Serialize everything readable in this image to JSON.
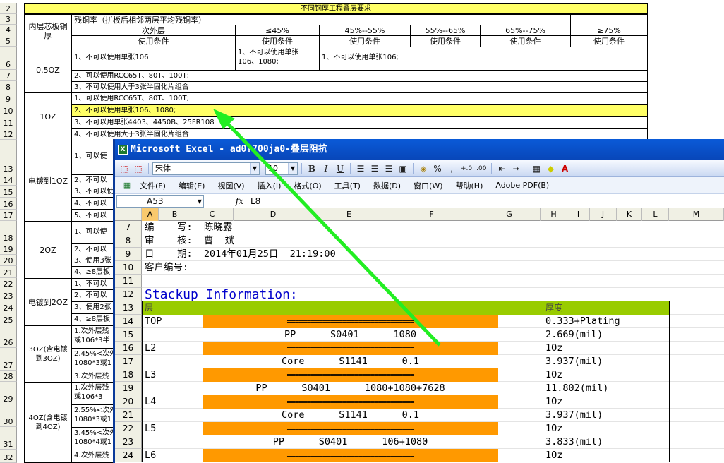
{
  "background_sheet": {
    "row_numbers": [
      "2",
      "3",
      "4",
      "5",
      "6",
      "7",
      "8",
      "9",
      "10",
      "11",
      "12",
      "13",
      "14",
      "15",
      "16",
      "17",
      "18",
      "19",
      "20",
      "21",
      "22",
      "23",
      "24",
      "25",
      "26",
      "27",
      "28",
      "29",
      "30",
      "31",
      "32"
    ],
    "title": "不同铜厚工程叠层要求",
    "header_inner": "内层芯板铜厚",
    "header_residual": "残铜率（拼板后相邻两层平均残铜率）",
    "header_secondary": "次外层",
    "ranges": [
      "≤45%",
      "45%--55%",
      "55%--65%",
      "65%--75%",
      "≥75%"
    ],
    "use_condition": "使用条件",
    "groups": [
      {
        "thickness": "0.5OZ",
        "lines": [
          "1、不可以使用单张106",
          "2、可以使用RCC65T、80T、100T;",
          "3、不可以使用大于3张半固化片组合"
        ],
        "col2": "1、不可以使用单张106、1080;",
        "col3": "1、不可以使用单张106;"
      },
      {
        "thickness": "1OZ",
        "lines": [
          "1、可以使用RCC65T、80T、100T;",
          "2、不可以使用单张106、1080;",
          "3、不可以用单张4403、4450B、25FR108",
          "4、不可以使用大于3张半固化片组合"
        ]
      },
      {
        "thickness": "电镀到1OZ",
        "lines": [
          "1、可以使",
          "2、不可以",
          "3、不可以使",
          "4、不可以",
          "5、不可以"
        ]
      },
      {
        "thickness": "2OZ",
        "lines": [
          "1、可以使",
          "2、不可以",
          "3、使用3张",
          "4、≥8层板"
        ]
      },
      {
        "thickness": "电镀到2OZ",
        "lines": [
          "1、不可以",
          "2、不可以",
          "3、使用2张",
          "4、≥8层板"
        ]
      },
      {
        "thickness": "3OZ(含电镀到3OZ)",
        "lines": [
          "1.次外层残",
          "或106*3半",
          "2.45%<次外",
          "1080*3或1",
          "3.次外层残"
        ]
      },
      {
        "thickness": "4OZ(含电镀到4OZ)",
        "lines": [
          "1.次外层残",
          "或106*3",
          "2.55%<次外",
          "1080*3或1",
          "3.45%<次外",
          "1080*4或1",
          "4.次外层残"
        ]
      }
    ]
  },
  "excel_window": {
    "title": "Microsoft Excel - ad0?700ja0-叠层阻抗",
    "toolbar": {
      "font_name": "宋体",
      "font_size": "10",
      "bold": "B",
      "italic": "I",
      "underline": "U",
      "percent": "%",
      "comma": ","
    },
    "menu": [
      "文件(F)",
      "编辑(E)",
      "视图(V)",
      "插入(I)",
      "格式(O)",
      "工具(T)",
      "数据(D)",
      "窗口(W)",
      "帮助(H)",
      "Adobe PDF(B)"
    ],
    "name_box": "A53",
    "fx_label": "fx",
    "formula_value": "L8",
    "columns": [
      "A",
      "B",
      "C",
      "D",
      "E",
      "F",
      "G",
      "H",
      "I",
      "J",
      "K",
      "L",
      "M"
    ],
    "selected_column": "A",
    "rows": [
      {
        "n": "7",
        "a": "编    写:  陈晓露"
      },
      {
        "n": "8",
        "a": "审    核:  曹  斌"
      },
      {
        "n": "9",
        "a": "日    期:  2014年01月25日  21:19:00"
      },
      {
        "n": "10",
        "a": "客户编号:"
      },
      {
        "n": "11",
        "a": ""
      },
      {
        "n": "12",
        "a": "Stackup Information:"
      },
      {
        "n": "13",
        "a": "层",
        "thick": "厚度"
      },
      {
        "n": "14",
        "a": "TOP",
        "mid": "================================",
        "thick": "0.333+Plating"
      },
      {
        "n": "15",
        "a": "",
        "mid": "PP      S0401      1080",
        "thick": "2.669(mil)"
      },
      {
        "n": "16",
        "a": "L2",
        "mid": "================================",
        "thick": "1Oz"
      },
      {
        "n": "17",
        "a": "",
        "mid": "Core      S1141      0.1",
        "thick": "3.937(mil)"
      },
      {
        "n": "18",
        "a": "L3",
        "mid": "================================",
        "thick": "1Oz"
      },
      {
        "n": "19",
        "a": "",
        "mid": "PP      S0401      1080+1080+7628",
        "thick": "11.802(mil)"
      },
      {
        "n": "20",
        "a": "L4",
        "mid": "================================",
        "thick": "1Oz"
      },
      {
        "n": "21",
        "a": "",
        "mid": "Core      S1141      0.1",
        "thick": "3.937(mil)"
      },
      {
        "n": "22",
        "a": "L5",
        "mid": "================================",
        "thick": "1Oz"
      },
      {
        "n": "23",
        "a": "",
        "mid": "PP      S0401      106+1080",
        "thick": "3.833(mil)"
      },
      {
        "n": "24",
        "a": "L6",
        "mid": "================================",
        "thick": "1Oz"
      }
    ]
  },
  "colors": {
    "highlight_yellow": "#ffff66",
    "orange": "#ff9900",
    "header_green": "#99cc00",
    "title_blue": "#0846b8",
    "arrow_green": "#22ee22",
    "stackup_title": "#0000cc"
  }
}
